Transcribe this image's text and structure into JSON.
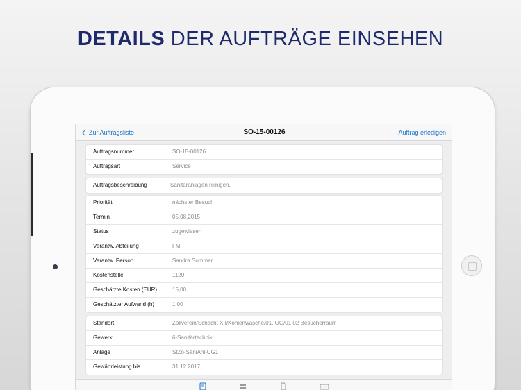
{
  "headline": {
    "bold": "DETAILS",
    "rest": "DER AUFTRÄGE EINSEHEN"
  },
  "nav": {
    "back_label": "Zur Auftragsliste",
    "title": "SO-15-00126",
    "action_label": "Auftrag erledigen"
  },
  "group1": [
    {
      "label": "Auftragsnummer",
      "value": "SO-15-00126"
    },
    {
      "label": "Auftragsart",
      "value": "Service"
    }
  ],
  "group2": [
    {
      "label": "Auftragsbeschreibung",
      "value": "Sanitäranlagen reinigen."
    }
  ],
  "group3": [
    {
      "label": "Priorität",
      "value": "nächster Besuch"
    },
    {
      "label": "Termin",
      "value": "05.08.2015"
    },
    {
      "label": "Status",
      "value": "zugewiesen"
    },
    {
      "label": "Verantw. Abteilung",
      "value": "FM"
    },
    {
      "label": "Verantw. Person",
      "value": "Sandra Sommer"
    },
    {
      "label": "Kostenstelle",
      "value": "1120"
    },
    {
      "label": "Geschätzte Kosten (EUR)",
      "value": "15,00"
    },
    {
      "label": "Geschätzter Aufwand (h)",
      "value": "1,00"
    }
  ],
  "group4": [
    {
      "label": "Standort",
      "value": "Zollverein/Schacht XII/Kohlenwäsche/01. OG/01.02 Besucherraum"
    },
    {
      "label": "Gewerk",
      "value": "6-Sanitärtechnik"
    },
    {
      "label": "Anlage",
      "value": "StZo-SaniAnl-UG1"
    },
    {
      "label": "Gewährleistung bis",
      "value": "31.12.2017"
    }
  ],
  "tabs": [
    {
      "icon": "clipboard-icon"
    },
    {
      "icon": "stack-icon"
    },
    {
      "icon": "document-icon"
    },
    {
      "icon": "more-icon"
    }
  ],
  "colors": {
    "accent": "#1a73c9",
    "headline": "#1e2a6b"
  }
}
